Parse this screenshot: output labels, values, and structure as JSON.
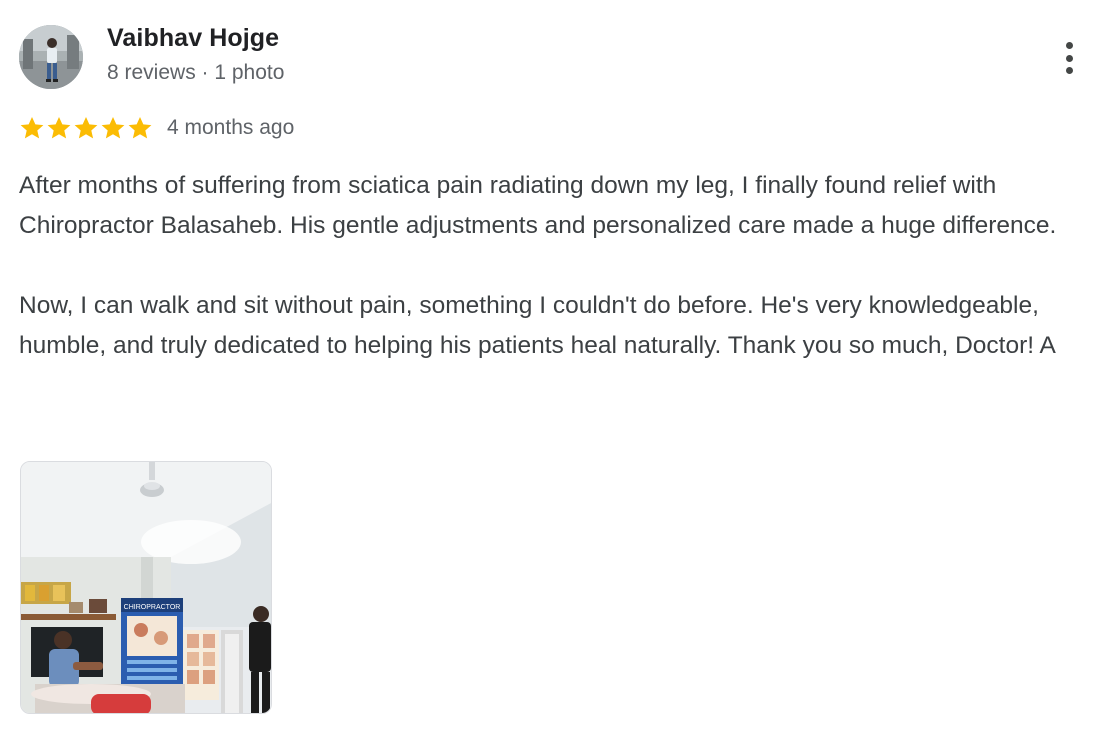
{
  "reviewer": {
    "name": "Vaibhav Hojge",
    "meta": "8 reviews · 1 photo",
    "avatar_icon": "person-photo-avatar"
  },
  "review": {
    "rating": 5,
    "max_rating": 5,
    "star_color": "#fbbc04",
    "timestamp": "4 months ago",
    "paragraphs": [
      "After months of suffering from sciatica pain radiating down my leg, I finally found relief with Chiropractor Balasaheb. His gentle adjustments and personalized care made a huge difference.",
      "Now, I can walk and sit without pain, something I couldn't do before. He's very knowledgeable, humble, and truly dedicated to helping his patients heal naturally. Thank you so much, Doctor! A"
    ]
  },
  "photo": {
    "poster_text": "CHIROPRACTOR"
  },
  "menu": {
    "icon": "more-vert-icon"
  }
}
